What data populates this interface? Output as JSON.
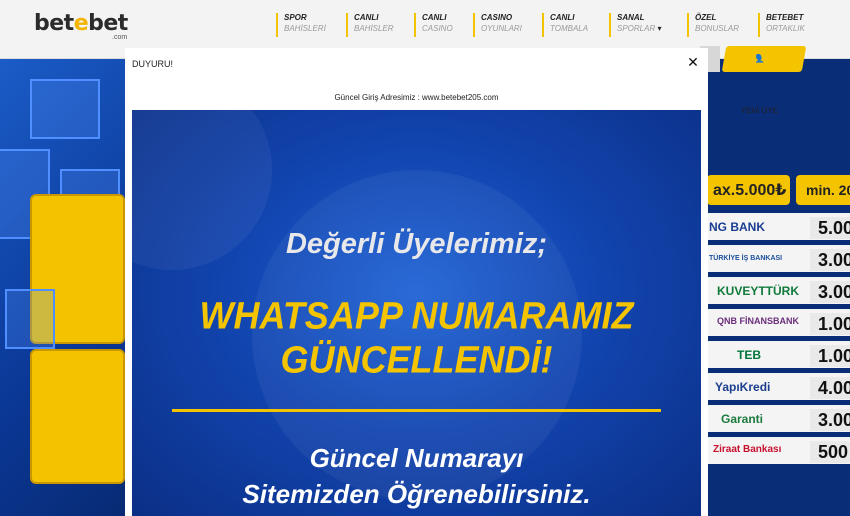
{
  "header": {
    "logo_main": "bet",
    "logo_mid": "e",
    "logo_end": "bet",
    "logo_sub": ".com",
    "nav": [
      {
        "title": "SPOR",
        "sub": "BAHİSLERİ"
      },
      {
        "title": "CANLI",
        "sub": "BAHİSLER"
      },
      {
        "title": "CANLI",
        "sub": "CASINO"
      },
      {
        "title": "CASINO",
        "sub": "OYUNLARI"
      },
      {
        "title": "CANLI",
        "sub": "TOMBALA"
      },
      {
        "title": "SANAL",
        "sub": "SPORLAR"
      },
      {
        "title": "ÖZEL",
        "sub": "BONUSLAR"
      },
      {
        "title": "BETEBET",
        "sub": "ORTAKLIK"
      }
    ],
    "register_label": "YENİ ÜYE"
  },
  "promo": {
    "max_label": "ax.5.000₺",
    "min_label": "min. 20",
    "banks": [
      {
        "name": "NG BANK",
        "value": "5.00",
        "color": "#1a3d8f"
      },
      {
        "name": "TÜRKİYE İŞ BANKASI",
        "value": "3.00",
        "color": "#1b4f9c"
      },
      {
        "name": "KUVEYTTÜRK",
        "value": "3.00",
        "color": "#0f7a3a"
      },
      {
        "name": "QNB FİNANSBANK",
        "value": "1.00",
        "color": "#6b2d7c"
      },
      {
        "name": "TEB",
        "value": "1.00",
        "color": "#00763b"
      },
      {
        "name": "YapıKredi",
        "value": "4.00",
        "color": "#1b3f8e"
      },
      {
        "name": "Garanti",
        "value": "3.00",
        "color": "#1d7a3e"
      },
      {
        "name": "Ziraat Bankası",
        "value": "500",
        "color": "#c8102e"
      }
    ]
  },
  "modal": {
    "title": "DUYURU!",
    "subtitle": "Güncel Giriş Adresimiz : www.betebet205.com",
    "banner": {
      "heading": "Değerli Üyelerimiz;",
      "headline_1": "WHATSAPP NUMARAMIZ",
      "headline_2": "GÜNCELLENDİ!",
      "footer_1": "Güncel Numarayı",
      "footer_2": "Sitemizden Öğrenebilirsiniz."
    }
  },
  "colors": {
    "accent": "#f5c400",
    "header_bg": "#f3f3f3",
    "banner_blue": "#1245b0"
  }
}
